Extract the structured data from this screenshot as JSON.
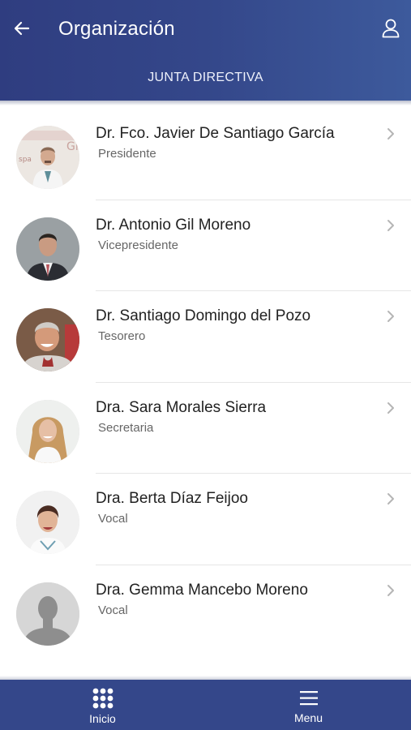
{
  "header": {
    "title": "Organización",
    "section": "JUNTA DIRECTIVA",
    "back_icon": "arrow-left-icon",
    "user_icon": "user-icon"
  },
  "members": [
    {
      "name": "Dr. Fco. Javier De Santiago García",
      "role": "Presidente"
    },
    {
      "name": "Dr. Antonio Gil Moreno",
      "role": "Vicepresidente"
    },
    {
      "name": "Dr. Santiago Domingo del Pozo",
      "role": "Tesorero"
    },
    {
      "name": "Dra. Sara Morales Sierra",
      "role": "Secretaria"
    },
    {
      "name": "Dra. Berta Díaz Feijoo",
      "role": "Vocal"
    },
    {
      "name": "Dra. Gemma Mancebo Moreno",
      "role": "Vocal"
    }
  ],
  "bottom_nav": {
    "home_label": "Inicio",
    "menu_label": "Menu"
  },
  "colors": {
    "header": "#34478a",
    "nav": "#34478a"
  }
}
